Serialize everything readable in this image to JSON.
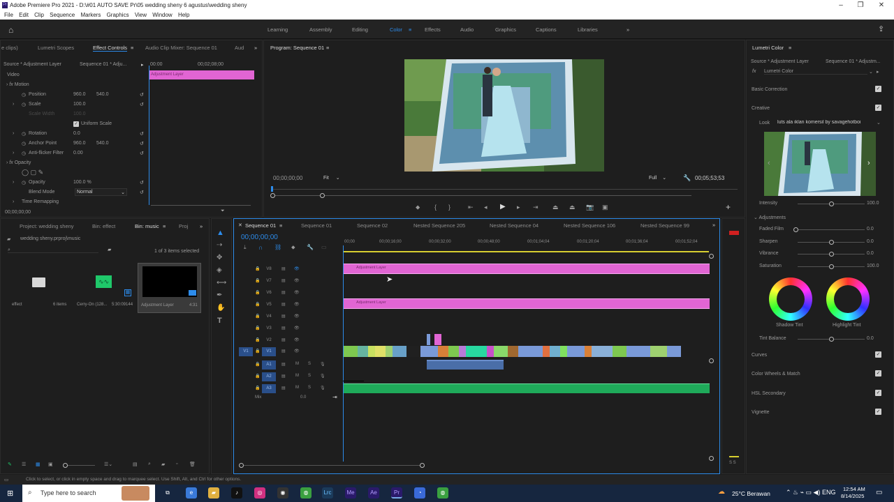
{
  "app": {
    "title": "Adobe Premiere Pro 2021 - D:\\#01 AUTO SAVE Pr\\05 wedding sheny 6 agustus\\wedding sheny"
  },
  "menu": [
    "File",
    "Edit",
    "Clip",
    "Sequence",
    "Markers",
    "Graphics",
    "View",
    "Window",
    "Help"
  ],
  "workspaces": [
    "Learning",
    "Assembly",
    "Editing",
    "Color",
    "Effects",
    "Audio",
    "Graphics",
    "Captions",
    "Libraries"
  ],
  "active_workspace": "Color",
  "effect_controls": {
    "tabs": [
      "e clips)",
      "Lumetri Scopes",
      "Effect Controls",
      "Audio Clip Mixer: Sequence 01",
      "Aud"
    ],
    "source": "Source * Adjustment Layer",
    "seq": "Sequence 01 * Adju...",
    "time_start": "00:00",
    "time_mid": "00;02;08;00",
    "clip_label": "Adjustment Layer",
    "video_label": "Video",
    "motion": "Motion",
    "position_label": "Position",
    "position_x": "960.0",
    "position_y": "540.0",
    "scale_label": "Scale",
    "scale": "100.0",
    "scale_width_label": "Scale Width",
    "scale_width": "100.0",
    "uniform_scale": "Uniform Scale",
    "rotation_label": "Rotation",
    "rotation": "0.0",
    "anchor_label": "Anchor Point",
    "anchor_x": "960.0",
    "anchor_y": "540.0",
    "antiflicker_label": "Anti-flicker Filter",
    "antiflicker": "0.00",
    "opacity_section": "Opacity",
    "opacity_label": "Opacity",
    "opacity": "100.0 %",
    "blend_label": "Blend Mode",
    "blend": "Normal",
    "time_remap": "Time Remapping",
    "timecode": "00;00;00;00"
  },
  "program": {
    "title": "Program: Sequence 01",
    "timecode": "00;00;00;00",
    "fit": "Fit",
    "quality": "Full",
    "duration": "00;05;53;53"
  },
  "project": {
    "tabs": [
      "Project: wedding sheny",
      "Bin: effect",
      "Bin: music",
      "Proj"
    ],
    "path": "wedding sheny.prproj\\music",
    "selected": "1 of 3 items selected",
    "items": [
      {
        "name": "effect",
        "meta": "6 items"
      },
      {
        "name": "Cerry-On (128...",
        "meta": "5:30:09144"
      },
      {
        "name": "Adjustment Layer",
        "meta": "4:31"
      }
    ]
  },
  "timeline": {
    "tabs": [
      "Sequence 01",
      "Sequence 01",
      "Sequence 02",
      "Nested Sequence 205",
      "Nested Sequence 04",
      "Nested Sequence 106",
      "Nested Sequence 99"
    ],
    "timecode": "00;00;00;00",
    "ruler": [
      "00;00",
      "00;00;16;00",
      "00;00;32;00",
      "00;00;48;00",
      "00;01;04;04",
      "00;01;20;04",
      "00;01;36;04",
      "00;01;52;04"
    ],
    "video_tracks": [
      "V8",
      "V7",
      "V6",
      "V5",
      "V4",
      "V3",
      "V2",
      "V1"
    ],
    "audio_tracks": [
      "A1",
      "A2",
      "A3"
    ],
    "mix_label": "Mix",
    "mix_value": "0.0",
    "clip_v8": "Adjustment Layer",
    "clip_v6": "Adjustment Layer"
  },
  "lumetri": {
    "title": "Lumetri Color",
    "source": "Source * Adjustment Layer",
    "seq": "Sequence 01 * Adjustm...",
    "fx_label": "Lumetri Color",
    "basic": "Basic Correction",
    "creative": "Creative",
    "look_label": "Look",
    "look": "luts ala iklan komersil by savagehotboi",
    "intensity_label": "Intensity",
    "intensity": "100.0",
    "adjustments": "Adjustments",
    "faded_label": "Faded Film",
    "faded": "0.0",
    "sharpen_label": "Sharpen",
    "sharpen": "0.0",
    "vibrance_label": "Vibrance",
    "vibrance": "0.0",
    "saturation_label": "Saturation",
    "saturation": "100.0",
    "shadow_tint": "Shadow Tint",
    "highlight_tint": "Highlight Tint",
    "tint_balance_label": "Tint Balance",
    "tint_balance": "0.0",
    "sections": [
      "Curves",
      "Color Wheels & Match",
      "HSL Secondary",
      "Vignette"
    ]
  },
  "status": "Click to select, or click in empty space and drag to marquee select. Use Shift, Alt, and Ctrl for other options.",
  "taskbar": {
    "search": "Type here to search",
    "weather": "25°C Berawan",
    "time": "12:54 AM",
    "date": "8/14/2025"
  }
}
